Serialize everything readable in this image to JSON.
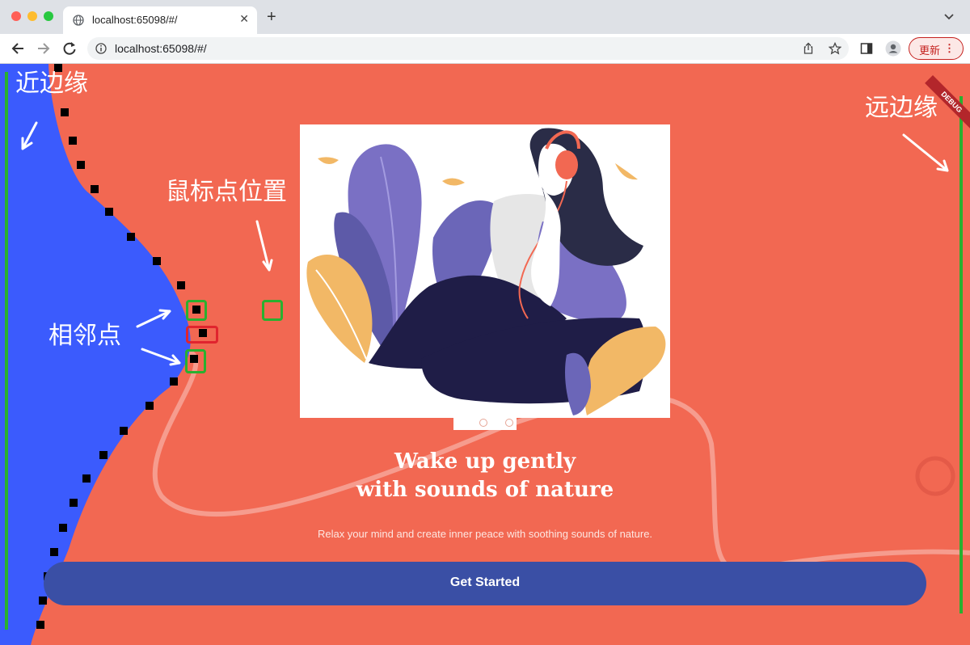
{
  "browser": {
    "tab_title": "localhost:65098/#/",
    "url": "localhost:65098/#/",
    "new_tab_symbol": "+",
    "close_symbol": "✕",
    "update_label": "更新",
    "update_menu": "⋮"
  },
  "app": {
    "debug_ribbon": "DEBUG",
    "headline_line1": "Wake up gently",
    "headline_line2": "with sounds of nature",
    "subtitle": "Relax your mind and create inner peace with soothing sounds of nature.",
    "cta_label": "Get Started",
    "pages_total": 2
  },
  "annotations": {
    "near_edge": "近边缘",
    "far_edge": "远边缘",
    "mouse_point": "鼠标点位置",
    "neighbor_points": "相邻点"
  },
  "colors": {
    "background": "#f26852",
    "wave": "#3b5bfd",
    "button": "#3a4fa5",
    "marker_green": "#29b02f",
    "marker_red": "#e0242e"
  },
  "icons": [
    "globe-icon",
    "back-icon",
    "forward-icon",
    "reload-icon",
    "info-icon",
    "share-icon",
    "bookmark-star-icon",
    "sidepanel-icon",
    "profile-icon",
    "chevron-down-icon"
  ]
}
